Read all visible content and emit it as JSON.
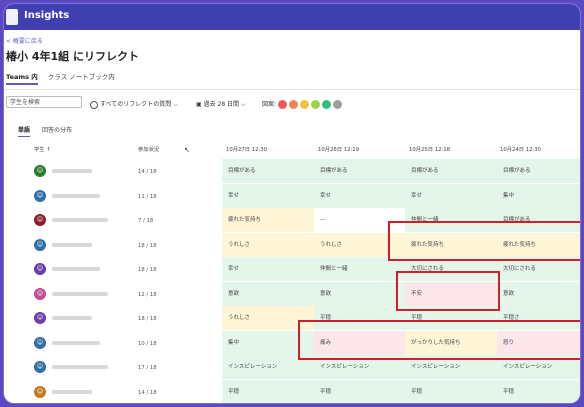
{
  "app": {
    "title": "Insights"
  },
  "nav": {
    "back": "< 概要に戻る"
  },
  "page": {
    "title": "椿小 4年1組 にリフレクト"
  },
  "tabs": [
    "Teams 内",
    "クラス ノートブック内"
  ],
  "filters": {
    "search_placeholder": "学生を検索",
    "question": "すべてのリフレクトの質問",
    "period": "過去 28 日間",
    "emotion_label": "図案:",
    "emotion_colors": [
      "#ef5b5b",
      "#f2825a",
      "#f5c23f",
      "#9bd24a",
      "#2fc07f",
      "#9e9e9e"
    ]
  },
  "subtabs": [
    "単語",
    "回答の分布"
  ],
  "columns": {
    "student": "学生 ↑",
    "participation": "参加状況",
    "dates": [
      "10月27日 12:30",
      "10月26日 12:19",
      "10月25日 12:18",
      "10月24日 12:30"
    ]
  },
  "colors": {
    "green": "#e4f5ea",
    "yellow": "#fdf5d6",
    "pink": "#fde6ea",
    "white": "#ffffff",
    "highlight": "#d01e2a"
  },
  "rows": [
    {
      "avatar_color": "#2d7a2d",
      "participation": "14 / 18",
      "cells": [
        {
          "text": "目標がある",
          "color": "green"
        },
        {
          "text": "目標がある",
          "color": "green"
        },
        {
          "text": "目標がある",
          "color": "green"
        },
        {
          "text": "目標がある",
          "color": "green"
        }
      ]
    },
    {
      "avatar_color": "#2f6ea8",
      "participation": "11 / 18",
      "cells": [
        {
          "text": "幸せ",
          "color": "green"
        },
        {
          "text": "幸せ",
          "color": "green"
        },
        {
          "text": "幸せ",
          "color": "green"
        },
        {
          "text": "集中",
          "color": "green"
        }
      ]
    },
    {
      "avatar_color": "#8d1f2a",
      "participation": "7 / 18",
      "cells": [
        {
          "text": "疲れた気持ち",
          "color": "yellow"
        },
        {
          "text": "—",
          "color": "white"
        },
        {
          "text": "仲間と一緒",
          "color": "green"
        },
        {
          "text": "目標がある",
          "color": "green"
        }
      ]
    },
    {
      "avatar_color": "#2f6ea8",
      "participation": "18 / 18",
      "cells": [
        {
          "text": "うれしさ",
          "color": "yellow"
        },
        {
          "text": "うれしさ",
          "color": "yellow"
        },
        {
          "text": "疲れた気持ち",
          "color": "yellow"
        },
        {
          "text": "疲れた気持ち",
          "color": "yellow"
        }
      ]
    },
    {
      "avatar_color": "#6b3fa8",
      "participation": "18 / 18",
      "cells": [
        {
          "text": "幸せ",
          "color": "green"
        },
        {
          "text": "仲間と一緒",
          "color": "green"
        },
        {
          "text": "大切にされる",
          "color": "green"
        },
        {
          "text": "大切にされる",
          "color": "green"
        }
      ]
    },
    {
      "avatar_color": "#c24b9a",
      "participation": "12 / 18",
      "cells": [
        {
          "text": "意欲",
          "color": "green"
        },
        {
          "text": "意欲",
          "color": "green"
        },
        {
          "text": "不安",
          "color": "pink"
        },
        {
          "text": "意欲",
          "color": "green"
        }
      ]
    },
    {
      "avatar_color": "#6b3fa8",
      "participation": "18 / 18",
      "cells": [
        {
          "text": "うれしさ",
          "color": "yellow"
        },
        {
          "text": "平穏",
          "color": "green"
        },
        {
          "text": "平穏",
          "color": "green"
        },
        {
          "text": "平穏さ",
          "color": "green"
        }
      ]
    },
    {
      "avatar_color": "#2f6ea8",
      "participation": "10 / 18",
      "cells": [
        {
          "text": "集中",
          "color": "green"
        },
        {
          "text": "痛み",
          "color": "pink"
        },
        {
          "text": "がっかりした気持ち",
          "color": "yellow"
        },
        {
          "text": "怒り",
          "color": "pink"
        }
      ]
    },
    {
      "avatar_color": "#2f6ea8",
      "participation": "17 / 18",
      "cells": [
        {
          "text": "インスピレーション",
          "color": "green"
        },
        {
          "text": "インスピレーション",
          "color": "green"
        },
        {
          "text": "インスピレーション",
          "color": "green"
        },
        {
          "text": "インスピレーション",
          "color": "green"
        }
      ]
    },
    {
      "avatar_color": "#c27a1f",
      "participation": "14 / 18",
      "cells": [
        {
          "text": "平穏",
          "color": "green"
        },
        {
          "text": "平穏",
          "color": "green"
        },
        {
          "text": "平穏",
          "color": "green"
        },
        {
          "text": "平穏",
          "color": "green"
        }
      ]
    }
  ]
}
